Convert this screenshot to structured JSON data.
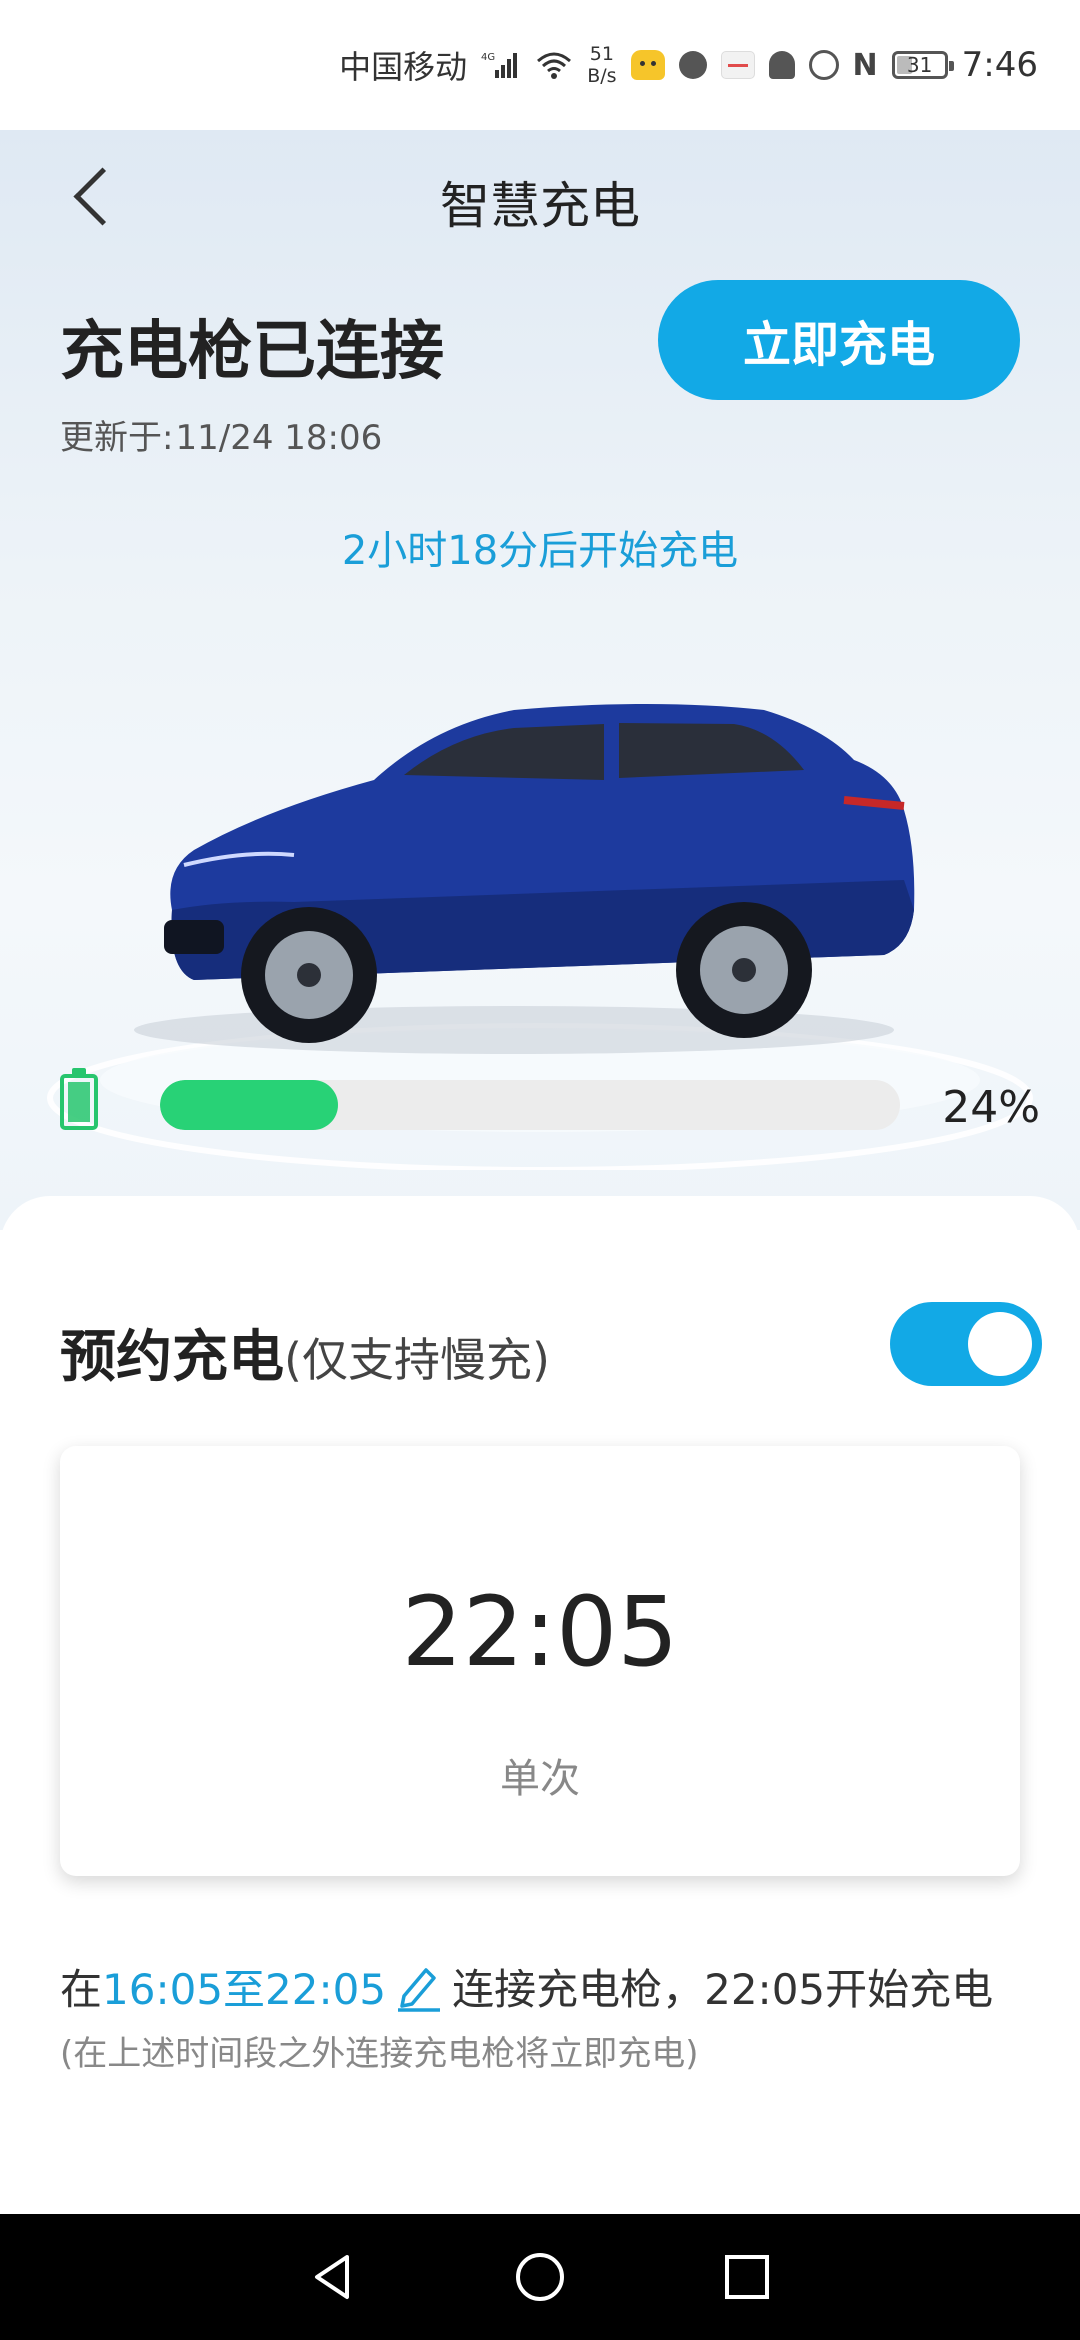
{
  "status_bar": {
    "carrier": "中国移动",
    "network": "4G",
    "net_speed_value": "51",
    "net_speed_unit": "B/s",
    "battery_level": "31",
    "time": "7:46"
  },
  "header": {
    "title": "智慧充电"
  },
  "charging_status": {
    "title": "充电枪已连接",
    "updated_label": "更新于:",
    "updated_time": "11/24 18:06",
    "charge_now_label": "立即充电",
    "countdown": "2小时18分后开始充电",
    "battery_percent": 24,
    "battery_percent_label": "24%"
  },
  "schedule": {
    "title": "预约充电",
    "subtitle": "(仅支持慢充)",
    "enabled": true,
    "start_time": "22:05",
    "repeat": "单次",
    "window_prefix": "在",
    "window_range": "16:05至22:05",
    "window_suffix": "连接充电枪，22:05开始充电",
    "note": "(在上述时间段之外连接充电枪将立即充电)"
  },
  "colors": {
    "accent": "#12a9e6",
    "progress": "#28d276",
    "countdown_text": "#1a9ed8"
  }
}
